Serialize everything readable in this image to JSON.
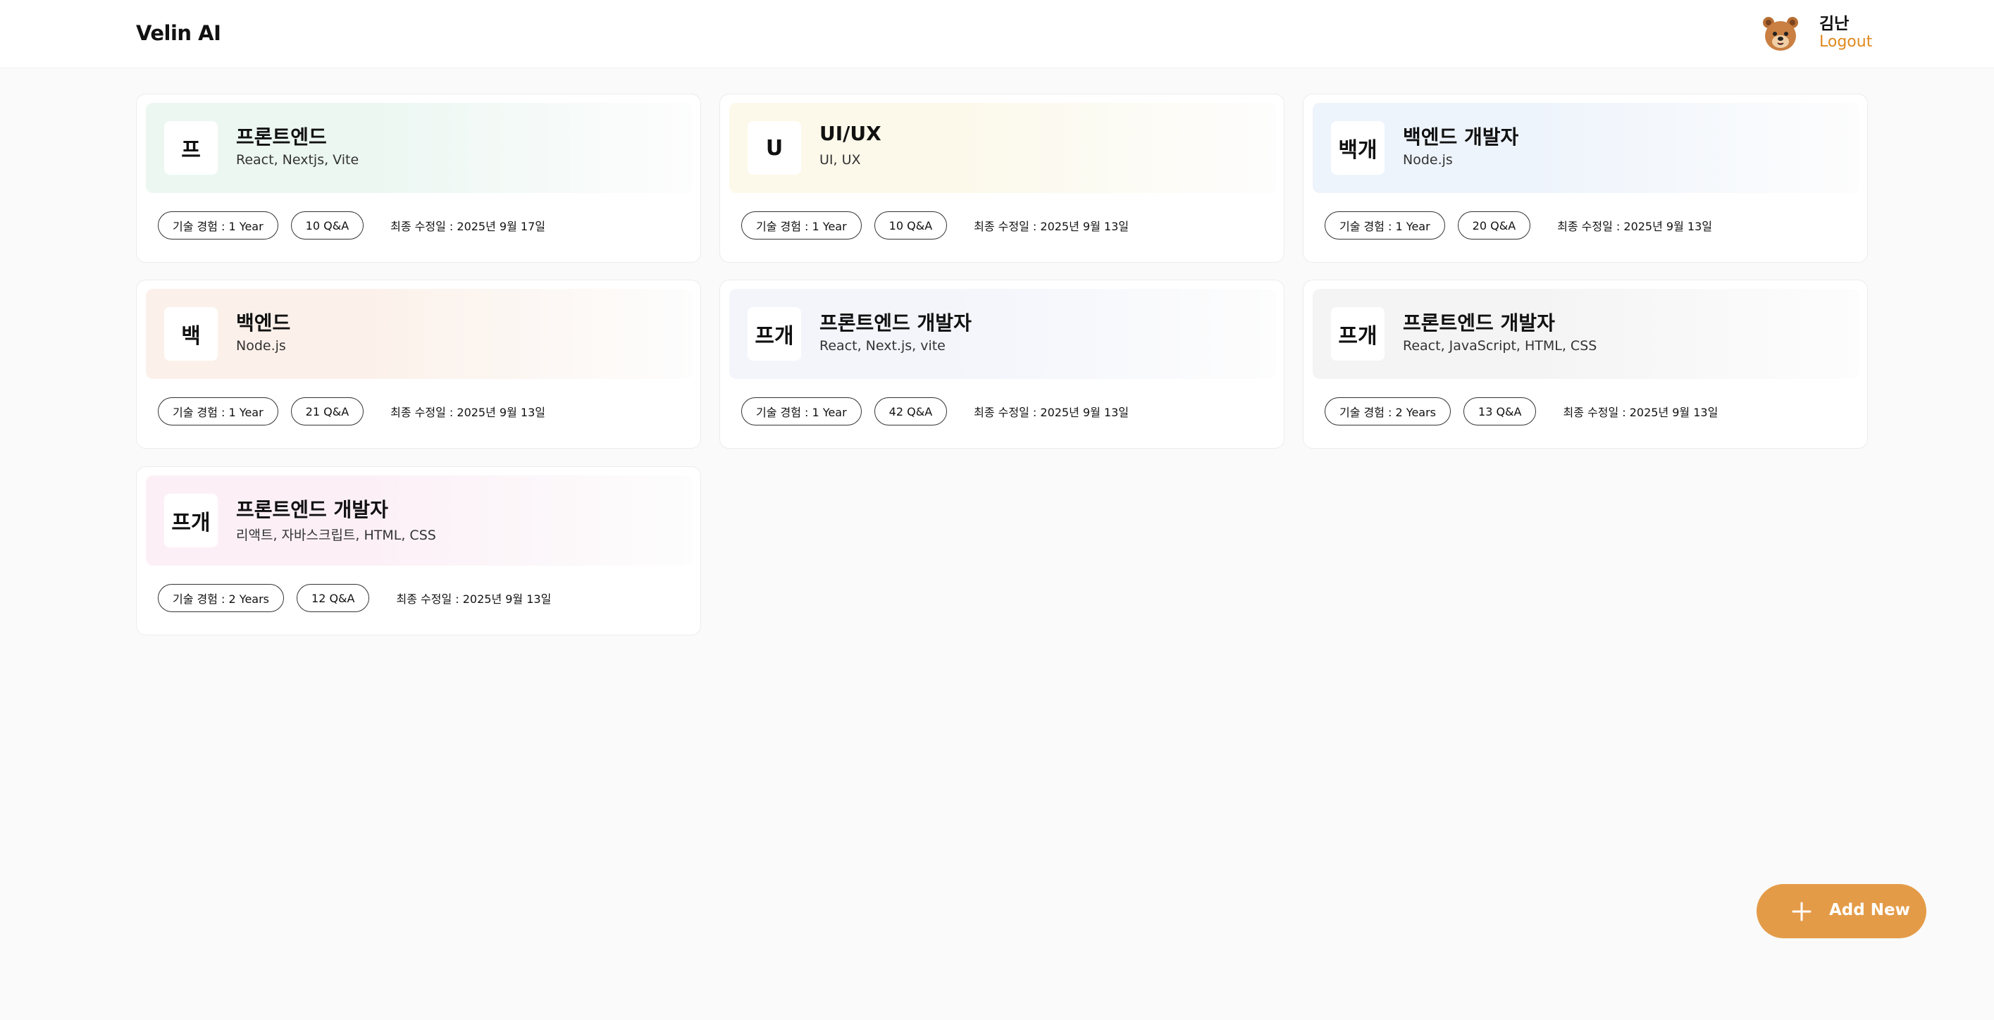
{
  "header": {
    "brand": "Velin AI",
    "user": {
      "name": "김난",
      "logout_label": "Logout",
      "avatar_icon": "bear-avatar-icon"
    }
  },
  "cards": [
    {
      "abbr": "프",
      "title": "프론트엔드",
      "subtitle": "React, Nextjs, Vite",
      "experience": "기술 경험 : 1 Year",
      "qa": "10 Q&A",
      "updated": "최종 수정일 : 2025년 9월 17일",
      "tint": "#ecf7f2"
    },
    {
      "abbr": "U",
      "title": "UI/UX",
      "subtitle": "UI, UX",
      "experience": "기술 경험 : 1 Year",
      "qa": "10 Q&A",
      "updated": "최종 수정일 : 2025년 9월 13일",
      "tint": "#fcf9ea"
    },
    {
      "abbr": "백개",
      "title": "백엔드 개발자",
      "subtitle": "Node.js",
      "experience": "기술 경험 : 1 Year",
      "qa": "20 Q&A",
      "updated": "최종 수정일 : 2025년 9월 13일",
      "tint": "#eef4fc"
    },
    {
      "abbr": "백",
      "title": "백엔드",
      "subtitle": "Node.js",
      "experience": "기술 경험 : 1 Year",
      "qa": "21 Q&A",
      "updated": "최종 수정일 : 2025년 9월 13일",
      "tint": "#fcf1ea"
    },
    {
      "abbr": "프개",
      "title": "프론트엔드 개발자",
      "subtitle": "React, Next.js, vite",
      "experience": "기술 경험 : 1 Year",
      "qa": "42 Q&A",
      "updated": "최종 수정일 : 2025년 9월 13일",
      "tint": "#f3f5fb"
    },
    {
      "abbr": "프개",
      "title": "프론트엔드 개발자",
      "subtitle": "React, JavaScript, HTML, CSS",
      "experience": "기술 경험 : 2 Years",
      "qa": "13 Q&A",
      "updated": "최종 수정일 : 2025년 9월 13일",
      "tint": "#f4f4f4"
    },
    {
      "abbr": "프개",
      "title": "프론트엔드 개발자",
      "subtitle": "리액트, 자바스크립트, HTML, CSS",
      "experience": "기술 경험 : 2 Years",
      "qa": "12 Q&A",
      "updated": "최종 수정일 : 2025년 9월 13일",
      "tint": "#fcf0f6"
    }
  ],
  "add_button": {
    "label": "Add New",
    "icon": "plus-icon"
  },
  "colors": {
    "accent": "#e49b48",
    "logout": "#e08a1e",
    "background": "#fafafa"
  }
}
